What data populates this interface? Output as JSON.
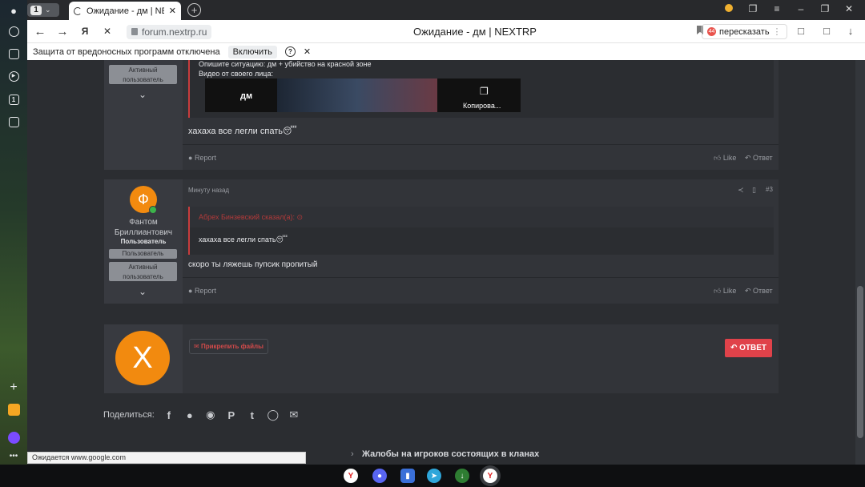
{
  "browser": {
    "tab_count": "1",
    "tab_title": "Ожидание - дм | NEXTRP",
    "url": "forum.nextrp.ru",
    "page_title": "Ожидание - дм | NEXTRP",
    "translate_label": "пересказать",
    "translate_badge": "44",
    "status_text": "Ожидается www.google.com"
  },
  "infobar": {
    "message": "Защита от вредоносных программ отключена",
    "enable_label": "Включить",
    "help_label": "?"
  },
  "post2": {
    "badge_active": "Активный пользователь",
    "quote_line1": "Опишите ситуацию: дм + убийство на красной зоне",
    "quote_line2": "Видео от своего лица:",
    "video_title": "дм",
    "video_copy": "Копирова...",
    "message": "хахаха все легли спать",
    "emoji": "😴",
    "report": "Report",
    "like": "Like",
    "reply": "Ответ"
  },
  "post3": {
    "avatar_letter": "Ф",
    "username": "Фантом Бриллиантович",
    "user_title": "Пользователь",
    "badge_user": "Пользователь",
    "badge_active": "Активный пользователь",
    "time": "Минуту назад",
    "number": "#3",
    "quote_author": "Абрех Бинзевский сказал(а):",
    "quote_text": "хахаха все легли спать",
    "emoji": "😴",
    "message": "скоро ты ляжешь пупсик пропитый",
    "report": "Report",
    "like": "Like",
    "reply": "Ответ"
  },
  "reply_box": {
    "avatar_letter": "X",
    "attach_label": "Прикрепить файлы",
    "reply_label": "ОТВЕТ"
  },
  "share": {
    "label": "Поделиться:",
    "icons": [
      "facebook-icon",
      "twitter-icon",
      "reddit-icon",
      "pinterest-icon",
      "tumblr-icon",
      "whatsapp-icon",
      "email-icon"
    ]
  },
  "breadcrumb": {
    "last": "Жалобы на игроков состоящих в кланах"
  },
  "colors": {
    "accent_red": "#e0424a",
    "avatar_orange": "#f28a0f",
    "page_bg": "#2b2d31"
  }
}
